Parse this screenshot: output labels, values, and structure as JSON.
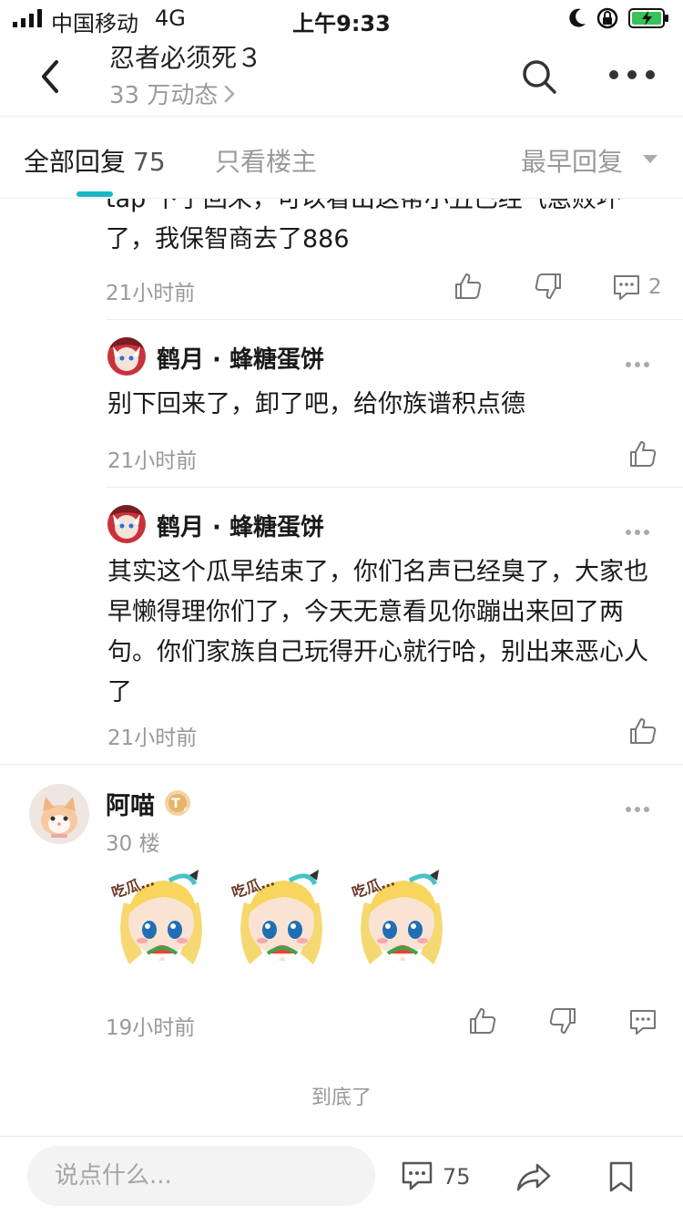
{
  "status_bar": {
    "carrier": "中国移动",
    "network": "4G",
    "time": "上午9:33"
  },
  "header": {
    "title": "忍者必须死３",
    "subtitle": "33 万动态",
    "subtitle_chevron": ">"
  },
  "tabs": {
    "all_label": "全部回复",
    "all_count": "75",
    "op_only_label": "只看楼主",
    "sort_label": "最早回复"
  },
  "colors": {
    "accent": "#18b7c6",
    "muted": "#999999"
  },
  "thread": {
    "partial_line1": "tap 下了回来，可以看出这帮小丑已经气急败坏",
    "partial_line2": "了，我保智商去了886",
    "time": "21小时前",
    "comment_count": "2",
    "sub_replies": [
      {
        "user": "鹤月 · 蜂糖蛋饼",
        "text": "别下回来了，卸了吧，给你族谱积点德",
        "time": "21小时前"
      },
      {
        "user": "鹤月 · 蜂糖蛋饼",
        "text": "其实这个瓜早结束了，你们名声已经臭了，大家也早懒得理你们了，今天无意看见你蹦出来回了两句。你们家族自己玩得开心就行哈，别出来恶心人了",
        "time": "21小时前"
      }
    ]
  },
  "post": {
    "user": "阿喵",
    "badge_letter": "T",
    "badge_level": "5",
    "floor": "30 楼",
    "sticker_text": "吃瓜…",
    "time": "19小时前"
  },
  "end_text": "到底了",
  "bottom_bar": {
    "input_placeholder": "说点什么...",
    "comment_count": "75"
  },
  "icons": [
    "back-icon",
    "search-icon",
    "more-icon",
    "like-icon",
    "dislike-icon",
    "comment-icon",
    "share-icon",
    "bookmark-icon"
  ]
}
